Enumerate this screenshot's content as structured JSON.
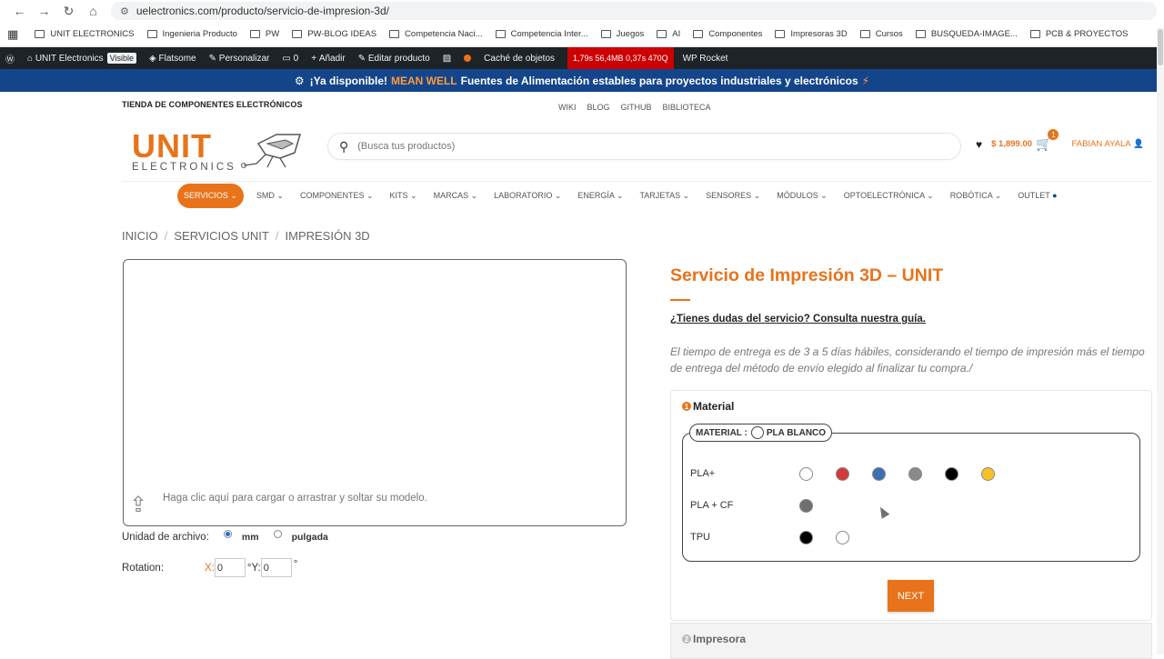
{
  "browser": {
    "url": "uelectronics.com/producto/servicio-de-impresion-3d/",
    "bookmarks": [
      "UNIT ELECTRONICS",
      "Ingenieria Producto",
      "PW",
      "PW-BLOG IDEAS",
      "Competencia Naci...",
      "Competencia Inter...",
      "Juegos",
      "AI",
      "Componentes",
      "Impresoras 3D",
      "Cursos",
      "BUSQUEDA-IMAGE...",
      "PCB & PROYECTOS"
    ]
  },
  "wpbar": {
    "site": "UNIT Electronics",
    "visible": "Visible",
    "theme": "Flatsome",
    "customize": "Personalizar",
    "comments": "0",
    "add": "Añadir",
    "edit": "Editar producto",
    "cache": "Caché de objetos",
    "perf": "1,79s  56,4MB  0,37s  470Q",
    "rocket": "WP Rocket"
  },
  "promo": {
    "lead": "¡Ya disponible!",
    "brand": "MEAN WELL",
    "rest": "Fuentes de Alimentación estables para proyectos industriales y electrónicos"
  },
  "header": {
    "tagline": "TIENDA DE COMPONENTES ELECTRÓNICOS",
    "toplinks": [
      "WIKI",
      "BLOG",
      "GITHUB",
      "BIBLIOTECA"
    ],
    "logo_big": "UNIT",
    "logo_small": "ELECTRONICS",
    "search_placeholder": "(Busca tus productos)",
    "cart_total": "$ 1,899.00",
    "cart_count": "1",
    "user": "FABIAN AYALA"
  },
  "nav": [
    "SERVICIOS",
    "SMD",
    "COMPONENTES",
    "KITS",
    "MARCAS",
    "LABORATORIO",
    "ENERGÍA",
    "TARJETAS",
    "SENSORES",
    "MÓDULOS",
    "OPTOELECTRÓNICA",
    "ROBÓTICA",
    "OUTLET"
  ],
  "breadcrumb": [
    "INICIO",
    "SERVICIOS UNIT",
    "IMPRESIÓN 3D"
  ],
  "uploader": {
    "text": "Haga clic aquí para cargar o arrastrar y soltar su modelo.",
    "unit_label": "Unidad de archivo:",
    "unit_mm": "mm",
    "unit_in": "pulgada",
    "rotation_label": "Rotation:",
    "rot_x_label": "X:",
    "rot_x": "0",
    "rot_y_label": "°Y:",
    "rot_y": "0",
    "rot_deg": "°"
  },
  "product": {
    "title": "Servicio de Impresión 3D – UNIT",
    "guide": "¿Tienes dudas del servicio? Consulta nuestra guía.",
    "delivery": "El tiempo de entrega es de 3 a 5 días hábiles, considerando el tiempo de impresión más el tiempo de entrega del método de envío elegido al finalizar tu compra./"
  },
  "step1": {
    "num": "1",
    "title": "Material",
    "legend_label": "MATERIAL :",
    "legend_value": "PLA BLANCO",
    "rows": [
      {
        "label": "PLA+",
        "colors": [
          "#ffffff",
          "#d23a3a",
          "#3c6fb5",
          "#8a8a8a",
          "#000000",
          "#f5c326"
        ]
      },
      {
        "label": "PLA + CF",
        "colors": [
          "#6f6f6f"
        ]
      },
      {
        "label": "TPU",
        "colors": [
          "#000000",
          "#ffffff"
        ]
      }
    ],
    "next": "NEXT"
  },
  "step2": {
    "num": "2",
    "title": "Impresora"
  }
}
